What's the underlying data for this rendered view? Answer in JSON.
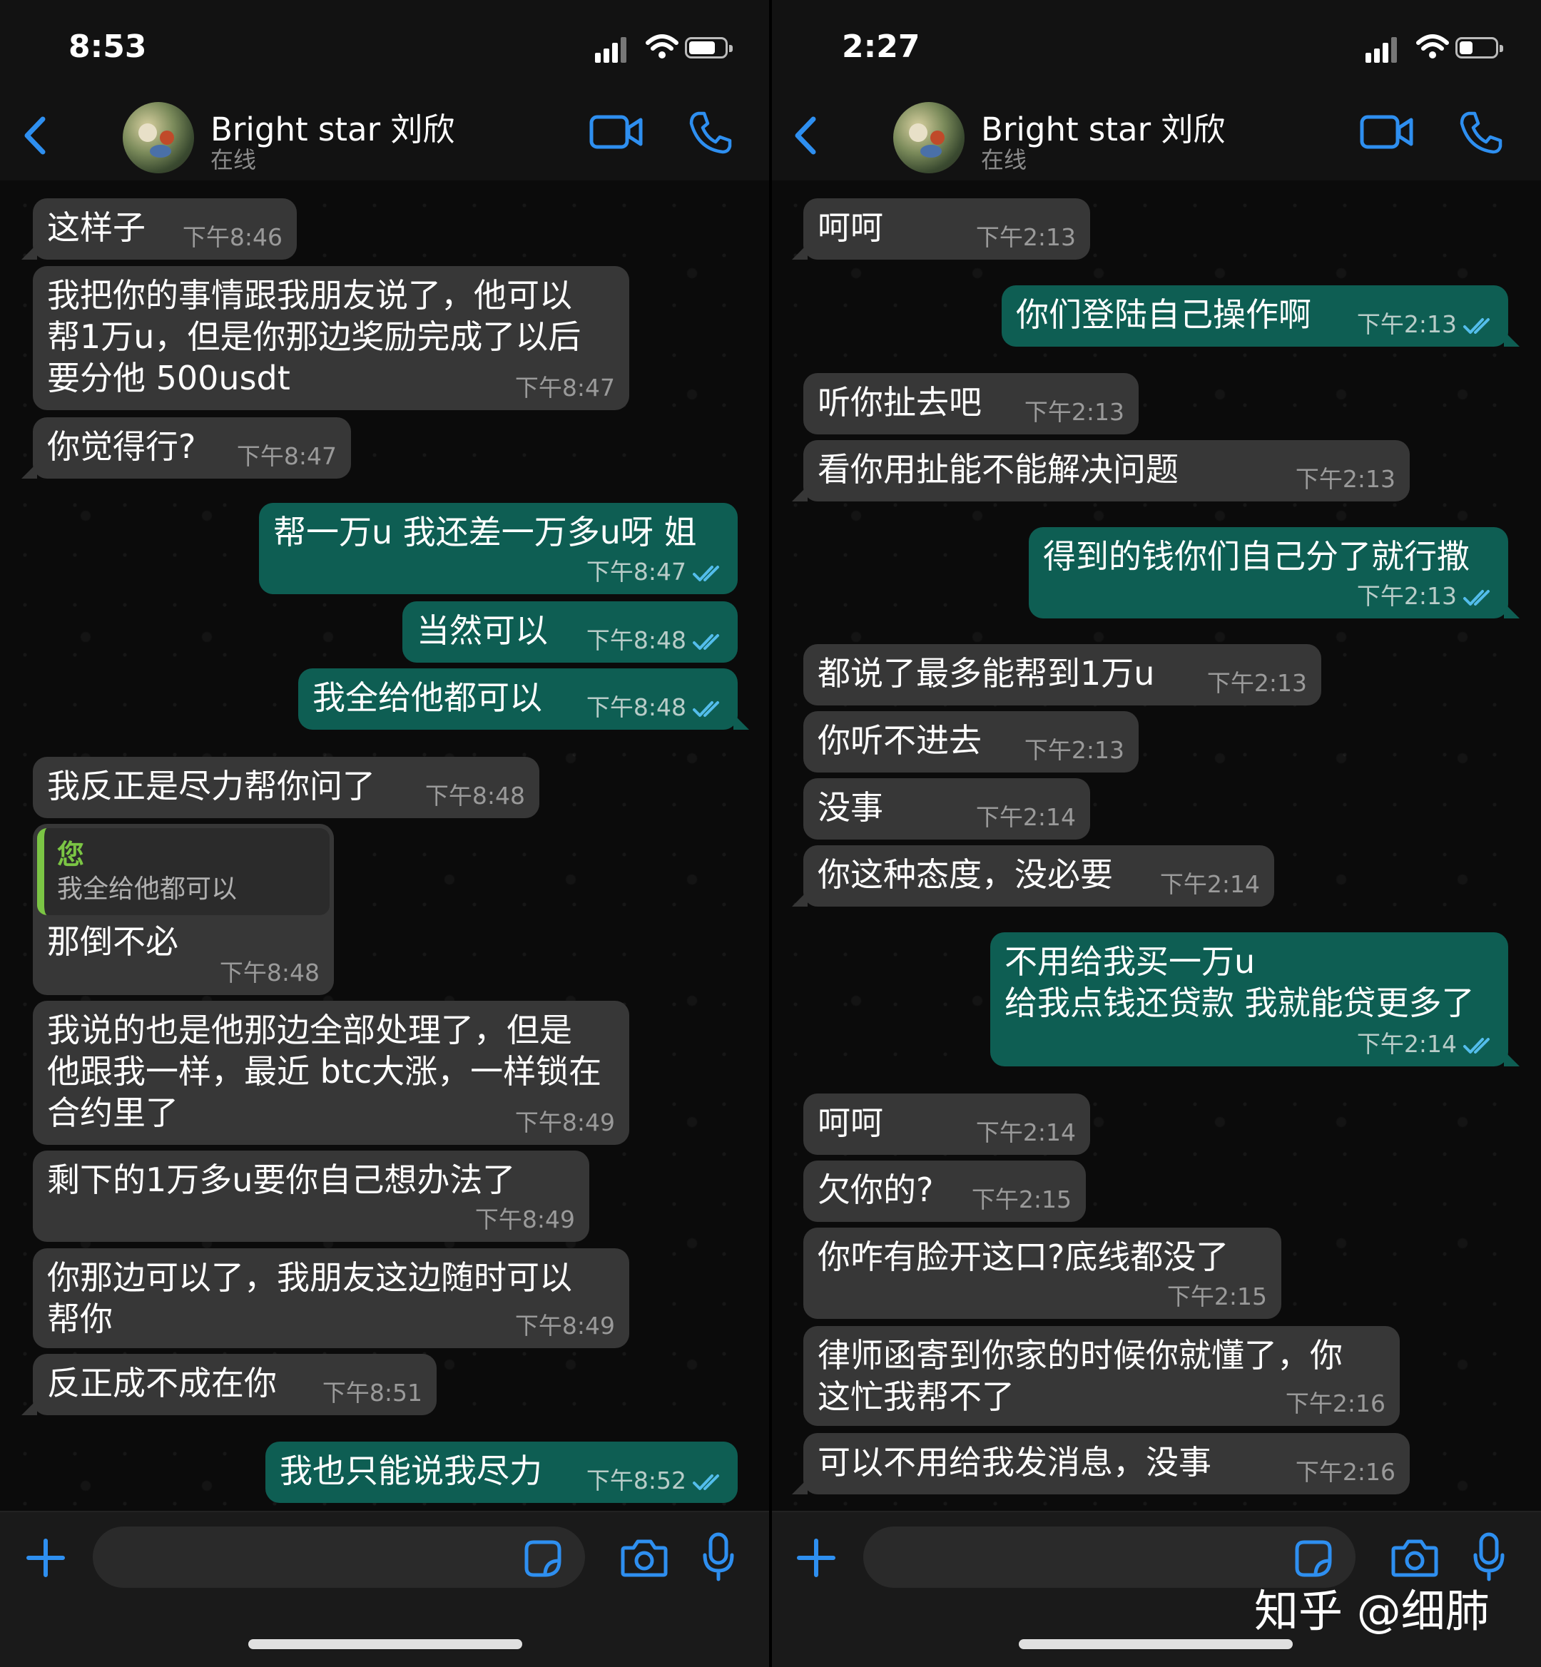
{
  "left": {
    "status_time": "8:53",
    "contact_name": "Bright star 刘欣",
    "contact_status": "在线",
    "input_placeholder": "",
    "messages": [
      {
        "text": "这样子",
        "time": "下午8:46"
      },
      {
        "text": "我把你的事情跟我朋友说了，他可以\n帮1万u，但是你那边奖励完成了以后\n要分他 500usdt",
        "time": "下午8:47"
      },
      {
        "text": "你觉得行?",
        "time": "下午8:47"
      },
      {
        "text": "帮一万u 我还差一万多u呀 姐",
        "time": "下午8:47"
      },
      {
        "text": "当然可以",
        "time": "下午8:48"
      },
      {
        "text": "我全给他都可以",
        "time": "下午8:48"
      },
      {
        "text": "我反正是尽力帮你问了",
        "time": "下午8:48"
      },
      {
        "quote_author": "您",
        "quote_text": "我全给他都可以",
        "text": "那倒不必",
        "time": "下午8:48"
      },
      {
        "text": "我说的也是他那边全部处理了，但是\n他跟我一样，最近 btc大涨，一样锁在\n合约里了",
        "time": "下午8:49"
      },
      {
        "text": "剩下的1万多u要你自己想办法了",
        "time": "下午8:49"
      },
      {
        "text": "你那边可以了，我朋友这边随时可以\n帮你",
        "time": "下午8:49"
      },
      {
        "text": "反正成不成在你",
        "time": "下午8:51"
      },
      {
        "text": "我也只能说我尽力",
        "time": "下午8:52"
      }
    ]
  },
  "right": {
    "status_time": "2:27",
    "contact_name": "Bright star 刘欣",
    "contact_status": "在线",
    "input_placeholder": "",
    "messages": [
      {
        "text": "呵呵",
        "time": "下午2:13"
      },
      {
        "text": "你们登陆自己操作啊",
        "time": "下午2:13"
      },
      {
        "text": "听你扯去吧",
        "time": "下午2:13"
      },
      {
        "text": "看你用扯能不能解决问题",
        "time": "下午2:13"
      },
      {
        "text": "得到的钱你们自己分了就行撒",
        "time": "下午2:13"
      },
      {
        "text": "都说了最多能帮到1万u",
        "time": "下午2:13"
      },
      {
        "text": "你听不进去",
        "time": "下午2:13"
      },
      {
        "text": "没事",
        "time": "下午2:14"
      },
      {
        "text": "你这种态度，没必要",
        "time": "下午2:14"
      },
      {
        "text": "不用给我买一万u\n给我点钱还贷款 我就能贷更多了",
        "time": "下午2:14"
      },
      {
        "text": "呵呵",
        "time": "下午2:14"
      },
      {
        "text": "欠你的?",
        "time": "下午2:15"
      },
      {
        "text": "你咋有脸开这口?底线都没了",
        "time": "下午2:15"
      },
      {
        "text": "律师函寄到你家的时候你就懂了，你\n这忙我帮不了",
        "time": "下午2:16"
      },
      {
        "text": "可以不用给我发消息，没事",
        "time": "下午2:16"
      }
    ]
  },
  "watermark": "知乎 @细肺",
  "colors": {
    "incoming_bubble": "#373737",
    "outgoing_bubble": "#0e5e53",
    "accent_blue": "#2e8ff0",
    "read_ticks": "#53bdeb",
    "quote_accent": "#7bc544"
  },
  "icons": [
    "back-icon",
    "video-icon",
    "phone-icon",
    "plus-icon",
    "sticker-icon",
    "camera-icon",
    "mic-icon",
    "read-receipt-icon"
  ]
}
